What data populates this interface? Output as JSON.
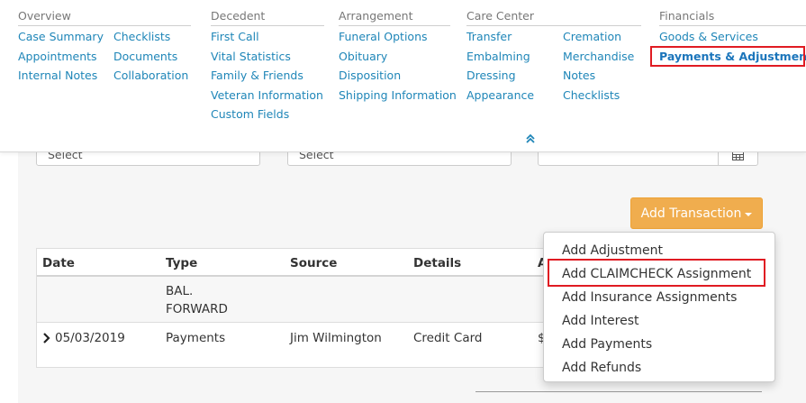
{
  "menu": {
    "sections": [
      {
        "title": "Overview",
        "columns": [
          [
            "Case Summary",
            "Appointments",
            "Internal Notes"
          ],
          [
            "Checklists",
            "Documents",
            "Collaboration"
          ]
        ]
      },
      {
        "title": "Decedent",
        "columns": [
          [
            "First Call",
            "Vital Statistics",
            "Family & Friends",
            "Veteran Information",
            "Custom Fields"
          ]
        ]
      },
      {
        "title": "Arrangement",
        "columns": [
          [
            "Funeral Options",
            "Obituary",
            "Disposition",
            "Shipping Information"
          ]
        ]
      },
      {
        "title": "Care Center",
        "columns": [
          [
            "Transfer",
            "Embalming",
            "Dressing",
            "Appearance"
          ],
          [
            "Cremation",
            "Merchandise",
            "Notes",
            "Checklists"
          ]
        ]
      },
      {
        "title": "Financials",
        "columns": [
          [
            "Goods & Services",
            "Payments & Adjustments"
          ]
        ]
      }
    ],
    "active_item": "Payments & Adjustments",
    "collapse_icon": "double-chevron-up-icon"
  },
  "filters": {
    "select1": "Select",
    "select2": "Select",
    "date_icon": "calendar-icon"
  },
  "add_transaction": {
    "label": "Add Transaction"
  },
  "table": {
    "headers": [
      "Date",
      "Type",
      "Source",
      "Details",
      "A"
    ],
    "rows": [
      {
        "date": "",
        "type": "BAL. FORWARD",
        "source": "",
        "details": "",
        "amount": ""
      },
      {
        "date": "05/03/2019",
        "type": "Payments",
        "source": "Jim Wilmington",
        "details": "Credit Card",
        "amount": "$"
      }
    ]
  },
  "dropdown": {
    "items": [
      "Add Adjustment",
      "Add CLAIMCHECK Assignment",
      "Add Insurance Assignments",
      "Add Interest",
      "Add Payments",
      "Add Refunds"
    ],
    "highlighted": "Add CLAIMCHECK Assignment"
  },
  "colors": {
    "link": "#1f86b8",
    "accent_button": "#f0ad4e",
    "highlight_box": "#e01b22"
  }
}
